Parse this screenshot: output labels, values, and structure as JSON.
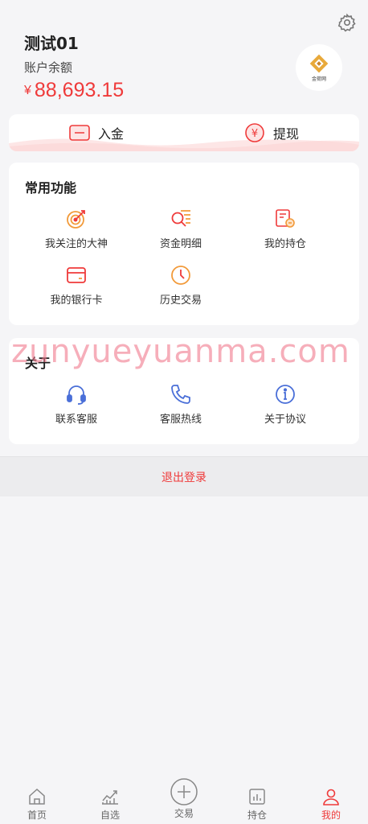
{
  "profile": {
    "username": "测试01",
    "balance_label": "账户余额",
    "currency_symbol": "¥",
    "balance": "88,693.15",
    "avatar_brand": "金荷网"
  },
  "fund_actions": {
    "deposit_label": "入金",
    "withdraw_label": "提现"
  },
  "common_functions": {
    "title": "常用功能",
    "items": [
      {
        "label": "我关注的大神",
        "icon": "target-icon"
      },
      {
        "label": "资金明细",
        "icon": "search-list-icon"
      },
      {
        "label": "我的持仓",
        "icon": "holdings-icon"
      },
      {
        "label": "我的银行卡",
        "icon": "bank-card-icon"
      },
      {
        "label": "历史交易",
        "icon": "clock-icon"
      }
    ]
  },
  "about": {
    "title": "关于",
    "items": [
      {
        "label": "联系客服",
        "icon": "headset-icon"
      },
      {
        "label": "客服热线",
        "icon": "phone-icon"
      },
      {
        "label": "关于协议",
        "icon": "info-icon"
      }
    ]
  },
  "logout_label": "退出登录",
  "watermark": "zunyueyuanma.com",
  "tabbar": {
    "items": [
      {
        "label": "首页",
        "icon": "home-icon"
      },
      {
        "label": "自选",
        "icon": "chart-icon"
      },
      {
        "label": "交易",
        "icon": "plus-circle-icon"
      },
      {
        "label": "持仓",
        "icon": "bars-icon"
      },
      {
        "label": "我的",
        "icon": "user-icon",
        "active": true
      }
    ]
  },
  "colors": {
    "accent": "#ef3a3a",
    "orange": "#f29a3a",
    "blue": "#4a6fd8",
    "background": "#f5f5f7"
  }
}
